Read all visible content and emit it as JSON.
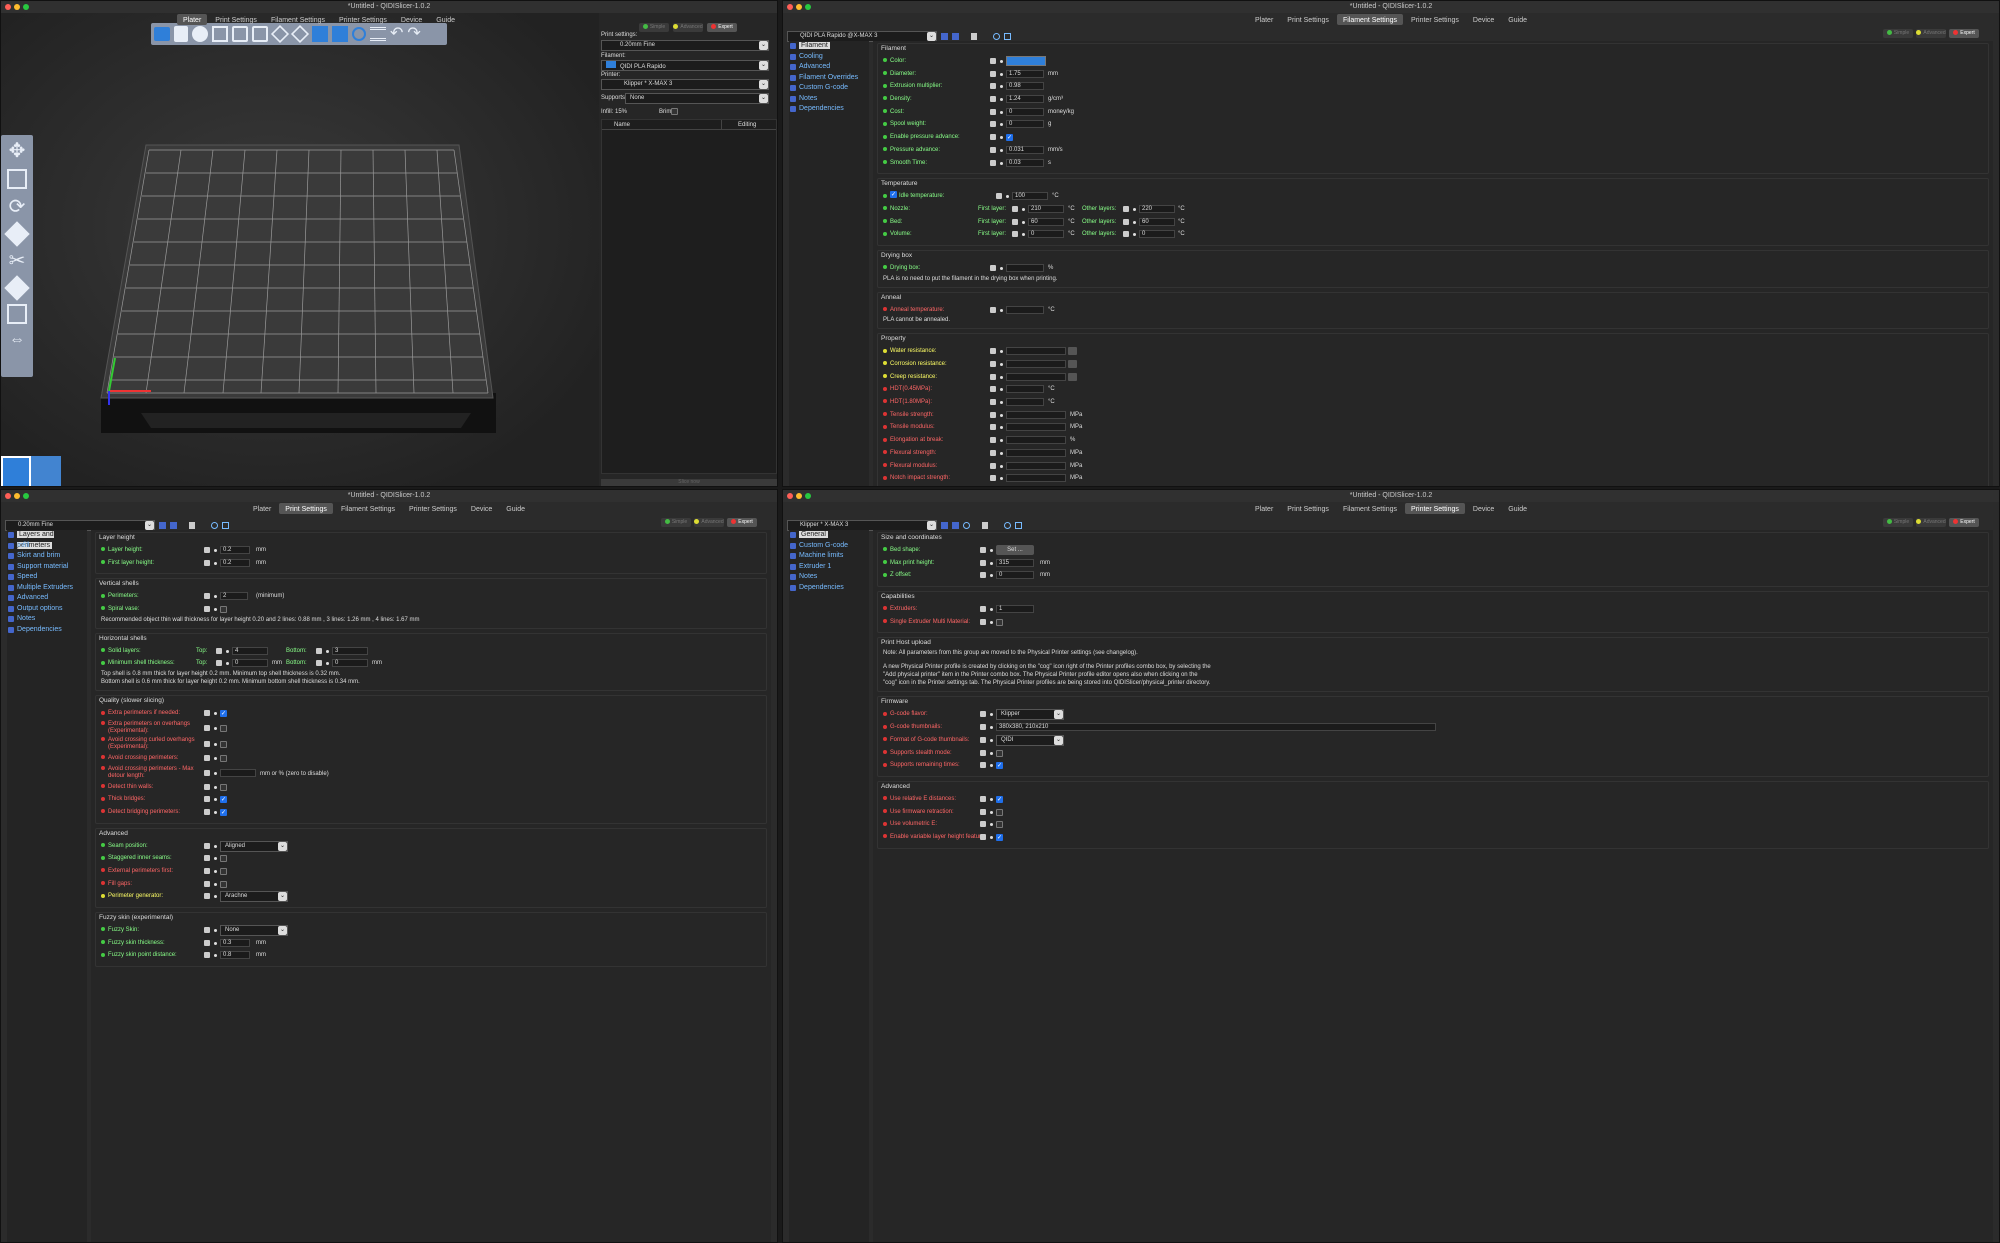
{
  "app_title": "*Untitled - QIDISlicer-1.0.2",
  "tabs": [
    "Plater",
    "Print Settings",
    "Filament Settings",
    "Printer Settings",
    "Device",
    "Guide"
  ],
  "modes": {
    "simple": "Simple",
    "advanced": "Advanced",
    "expert": "Expert"
  },
  "plater": {
    "print_settings_label": "Print settings:",
    "print_settings_value": "0.20mm Fine",
    "filament_label": "Filament:",
    "filament_value": "QIDI PLA Rapido",
    "printer_label": "Printer:",
    "printer_value": "Klipper * X-MAX 3",
    "supports_label": "Supports:",
    "supports_value": "None",
    "infill_label": "Infill:",
    "infill_value": "15%",
    "brim_label": "Brim:",
    "col_name": "Name",
    "col_editing": "Editing",
    "slice_btn": "Slice now"
  },
  "filament": {
    "preset": "QIDI PLA Rapido @X-MAX 3",
    "pages": [
      "Filament",
      "Cooling",
      "Advanced",
      "Filament Overrides",
      "Custom G-code",
      "Notes",
      "Dependencies"
    ],
    "g_filament": "Filament",
    "color": "Color:",
    "diameter": "Diameter:",
    "diameter_v": "1.75",
    "diameter_u": "mm",
    "extr_mult": "Extrusion multiplier:",
    "extr_mult_v": "0.98",
    "density": "Density:",
    "density_v": "1.24",
    "density_u": "g/cm³",
    "cost": "Cost:",
    "cost_v": "0",
    "cost_u": "money/kg",
    "spool": "Spool weight:",
    "spool_v": "0",
    "spool_u": "g",
    "pa_en": "Enable pressure advance:",
    "pa": "Pressure advance:",
    "pa_v": "0.031",
    "pa_u": "mm/s",
    "smooth": "Smooth Time:",
    "smooth_v": "0.03",
    "smooth_u": "s",
    "g_temp": "Temperature",
    "idle": "Idle temperature:",
    "idle_v": "100",
    "degc": "°C",
    "nozzle": "Nozzle:",
    "bed": "Bed:",
    "volume": "Volume:",
    "first_layer": "First layer:",
    "other_layers": "Other layers:",
    "nozzle_f": "210",
    "nozzle_o": "220",
    "bed_f": "60",
    "bed_o": "60",
    "vol_f": "0",
    "vol_o": "0",
    "g_dry": "Drying box",
    "dry": "Drying box:",
    "pct": "%",
    "dry_note": "PLA is no need to put the filament in the drying box when printing.",
    "g_anneal": "Anneal",
    "anneal": "Anneal temperature:",
    "anneal_note": "PLA cannot be annealed.",
    "g_prop": "Property",
    "water": "Water resistance:",
    "corrosion": "Corrosion resistance:",
    "creep": "Creep resistance:",
    "hdt45": "HDT(0.45MPa):",
    "hdt180": "HDT(1.80MPa):",
    "tensile_s": "Tensile strength:",
    "tensile_m": "Tensile modulus:",
    "elong": "Elongation at break:",
    "flex_s": "Flexural strength:",
    "flex_m": "Flexural modulus:",
    "notch": "Notch impact strength:",
    "mpa": "MPa"
  },
  "print": {
    "preset": "0.20mm Fine",
    "pages": [
      "Layers and perimeters",
      "Infill",
      "Skirt and brim",
      "Support material",
      "Speed",
      "Multiple Extruders",
      "Advanced",
      "Output options",
      "Notes",
      "Dependencies"
    ],
    "g_layer": "Layer height",
    "layer_h": "Layer height:",
    "layer_h_v": "0.2",
    "first_h": "First layer height:",
    "first_h_v": "0.2",
    "mm": "mm",
    "g_vshell": "Vertical shells",
    "perims": "Perimeters:",
    "perims_v": "2",
    "minimum": "(minimum)",
    "spiral": "Spiral vase:",
    "vnote": "Recommended object thin wall thickness for layer height 0.20 and 2 lines: 0.88 mm , 3 lines: 1.26 mm , 4 lines: 1.67 mm",
    "g_hshell": "Horizontal shells",
    "solid": "Solid layers:",
    "top": "Top:",
    "bottom": "Bottom:",
    "solid_top": "4",
    "solid_bot": "3",
    "minshell": "Minimum shell thickness:",
    "min_top": "0",
    "min_bot": "0",
    "hnote1": "Top shell is 0.8 mm thick for layer height 0.2 mm. Minimum top shell thickness is 0.32 mm.",
    "hnote2": "Bottom shell is 0.6 mm thick for layer height 0.2 mm. Minimum bottom shell thickness is 0.34 mm.",
    "g_quality": "Quality (slower slicing)",
    "q1": "Extra perimeters if needed:",
    "q2a": "Extra perimeters on overhangs",
    "q2b": "(Experimental):",
    "q3a": "Avoid crossing curled overhangs",
    "q3b": "(Experimental):",
    "q4": "Avoid crossing perimeters:",
    "q5a": "Avoid crossing perimeters - Max",
    "q5b": "detour length:",
    "q5u": "mm or % (zero to disable)",
    "q6": "Detect thin walls:",
    "q7": "Thick bridges:",
    "q8": "Detect bridging perimeters:",
    "g_adv": "Advanced",
    "seam": "Seam position:",
    "seam_v": "Aligned",
    "stag": "Staggered inner seams:",
    "ext_first": "External perimeters first:",
    "fill_gaps": "Fill gaps:",
    "pgen": "Perimeter generator:",
    "pgen_v": "Arachne",
    "g_fuzzy": "Fuzzy skin (experimental)",
    "fz": "Fuzzy Skin:",
    "fz_v": "None",
    "fz_t": "Fuzzy skin thickness:",
    "fz_t_v": "0.3",
    "fz_d": "Fuzzy skin point distance:",
    "fz_d_v": "0.8"
  },
  "printer": {
    "preset": "Klipper * X-MAX 3",
    "pages": [
      "General",
      "Custom G-code",
      "Machine limits",
      "Extruder 1",
      "Notes",
      "Dependencies"
    ],
    "g_size": "Size and coordinates",
    "bed_shape": "Bed shape:",
    "set_btn": "Set ...",
    "max_h": "Max print height:",
    "max_h_v": "315",
    "z_off": "Z offset:",
    "z_off_v": "0",
    "mm": "mm",
    "g_cap": "Capabilities",
    "extruders": "Extruders:",
    "extruders_v": "1",
    "semm": "Single Extruder Multi Material:",
    "g_host": "Print Host upload",
    "host1": "Note: All parameters from this group are moved to the Physical Printer settings (see changelog).",
    "host2": "A new Physical Printer profile is created by clicking on the \"cog\" icon right of the Printer profiles combo box, by selecting the \"Add physical printer\" item in the Printer combo box. The Physical Printer profile editor opens also when clicking on the \"cog\" icon in the Printer settings tab. The Physical Printer profiles are being stored into QIDISlicer/physical_printer directory.",
    "g_fw": "Firmware",
    "flavor": "G-code flavor:",
    "flavor_v": "Klipper",
    "thumbs": "G-code thumbnails:",
    "thumbs_v": "380x380, 210x210",
    "thumb_fmt": "Format of G-code thumbnails:",
    "thumb_fmt_v": "QIDI",
    "stealth": "Supports stealth mode:",
    "remain": "Supports remaining times:",
    "g_adv": "Advanced",
    "rel_e": "Use relative E distances:",
    "fw_retract": "Use firmware retraction:",
    "vol_e": "Use volumetric E:",
    "var_layer": "Enable variable layer height feature:"
  }
}
